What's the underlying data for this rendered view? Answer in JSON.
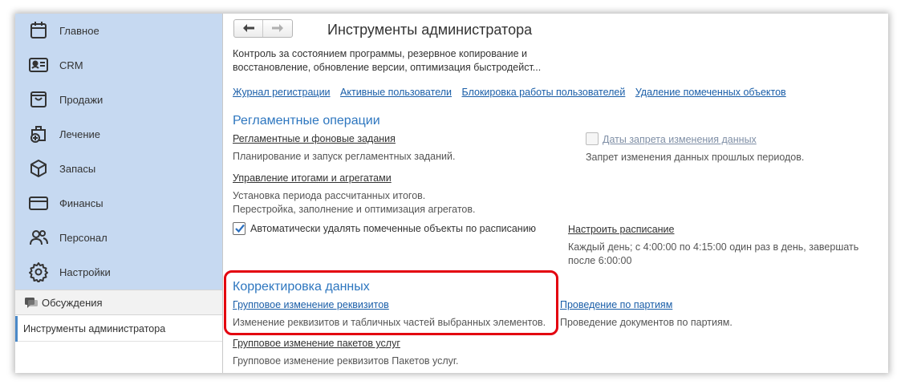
{
  "sidebar": {
    "sections": [
      {
        "label": "Главное",
        "icon": "calendar-icon"
      },
      {
        "label": "CRM",
        "icon": "contact-card-icon"
      },
      {
        "label": "Продажи",
        "icon": "shopping-bag-icon"
      },
      {
        "label": "Лечение",
        "icon": "medical-case-icon"
      },
      {
        "label": "Запасы",
        "icon": "box-icon"
      },
      {
        "label": "Финансы",
        "icon": "credit-card-icon"
      },
      {
        "label": "Персонал",
        "icon": "people-icon"
      },
      {
        "label": "Настройки",
        "icon": "gear-icon"
      }
    ],
    "discussions_label": "Обсуждения",
    "open_window_label": "Инструменты администратора",
    "accent_color": "#c6d9f1"
  },
  "header": {
    "back_glyph": "🡐",
    "forward_glyph": "🡒",
    "title": "Инструменты администратора"
  },
  "description": "Контроль за состоянием программы, резервное копирование и восстановление, обновление версии, оптимизация быстродейст...",
  "top_links": [
    "Журнал регистрации",
    "Активные пользователи",
    "Блокировка работы пользователей",
    "Удаление помеченных объектов"
  ],
  "routine": {
    "heading": "Регламентные операции",
    "scheduled_jobs_link": "Регламентные и фоновые задания",
    "scheduled_jobs_desc": "Планирование и запуск регламентных заданий.",
    "totals_link": "Управление итогами и агрегатами",
    "totals_desc_1": "Установка периода рассчитанных итогов.",
    "totals_desc_2": "Перестройка, заполнение и оптимизация агрегатов.",
    "auto_delete_label": "Автоматически удалять помеченные объекты по расписанию",
    "auto_delete_checked": true,
    "schedule_link": "Настроить расписание",
    "schedule_desc_1": "Каждый день; с 4:00:00 по 4:15:00 один раз в день, завершать",
    "schedule_desc_2": "после 6:00:00",
    "closing_dates_label": "Даты запрета изменения данных",
    "closing_dates_checked": false,
    "closing_dates_desc": "Запрет изменения данных прошлых периодов."
  },
  "correction": {
    "heading": "Корректировка данных",
    "bulk_edit_link": "Групповое изменение реквизитов",
    "bulk_edit_desc": "Изменение реквизитов и табличных частей выбранных элементов.",
    "batch_posting_link": "Проведение по партиям",
    "batch_posting_desc": "Проведение документов по партиям.",
    "service_packages_link": "Групповое изменение пакетов услуг",
    "service_packages_desc": "Групповое изменение реквизитов Пакетов услуг."
  },
  "colors": {
    "heading_blue": "#2d76bf",
    "link_blue": "#1a5ea8",
    "highlight_red": "#e3000f"
  }
}
